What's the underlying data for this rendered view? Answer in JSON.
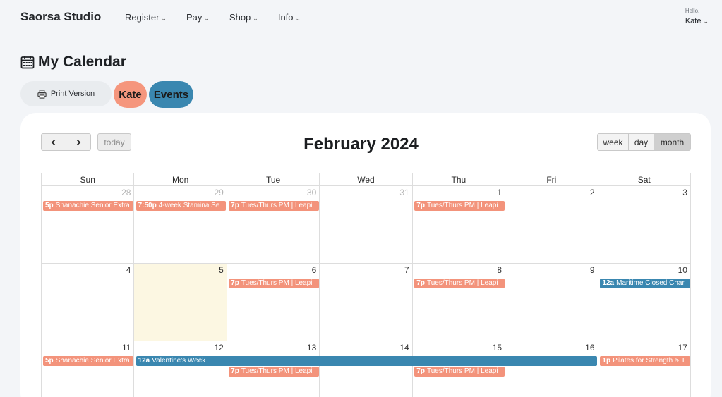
{
  "nav": {
    "brand": "Saorsa Studio",
    "menu": [
      {
        "label": "Register"
      },
      {
        "label": "Pay"
      },
      {
        "label": "Shop"
      },
      {
        "label": "Info"
      }
    ],
    "user": {
      "greeting": "Hello,",
      "name": "Kate"
    }
  },
  "page": {
    "title": "My Calendar",
    "print_label": "Print Version",
    "filters": [
      {
        "label": "Kate",
        "color": "#f5967d"
      },
      {
        "label": "Events",
        "color": "#3a87b0"
      }
    ]
  },
  "toolbar": {
    "prev_icon": "chevron-left-icon",
    "next_icon": "chevron-right-icon",
    "today_label": "today",
    "month_title": "February 2024",
    "views": [
      {
        "label": "week"
      },
      {
        "label": "day"
      },
      {
        "label": "month",
        "active": true
      }
    ]
  },
  "calendar": {
    "days_of_week": [
      "Sun",
      "Mon",
      "Tue",
      "Wed",
      "Thu",
      "Fri",
      "Sat"
    ],
    "weeks": [
      {
        "days": [
          {
            "num": "28",
            "other": true
          },
          {
            "num": "29",
            "other": true
          },
          {
            "num": "30",
            "other": true
          },
          {
            "num": "31",
            "other": true
          },
          {
            "num": "1"
          },
          {
            "num": "2"
          },
          {
            "num": "3"
          }
        ],
        "events": [
          {
            "time": "5p",
            "title": "Shanachie Senior Extra",
            "color": "orange",
            "col": 0,
            "span": 1,
            "lane": 0
          },
          {
            "time": "7:50p",
            "title": "4-week Stamina Se",
            "color": "orange",
            "col": 1,
            "span": 1,
            "lane": 0
          },
          {
            "time": "7p",
            "title": "Tues/Thurs PM | Leapi",
            "color": "orange",
            "col": 2,
            "span": 1,
            "lane": 0
          },
          {
            "time": "7p",
            "title": "Tues/Thurs PM | Leapi",
            "color": "orange",
            "col": 4,
            "span": 1,
            "lane": 0
          }
        ]
      },
      {
        "days": [
          {
            "num": "4"
          },
          {
            "num": "5",
            "today": true
          },
          {
            "num": "6"
          },
          {
            "num": "7"
          },
          {
            "num": "8"
          },
          {
            "num": "9"
          },
          {
            "num": "10"
          }
        ],
        "events": [
          {
            "time": "7p",
            "title": "Tues/Thurs PM | Leapi",
            "color": "orange",
            "col": 2,
            "span": 1,
            "lane": 0
          },
          {
            "time": "7p",
            "title": "Tues/Thurs PM | Leapi",
            "color": "orange",
            "col": 4,
            "span": 1,
            "lane": 0
          },
          {
            "time": "12a",
            "title": "Maritime Closed Char",
            "color": "blue",
            "col": 6,
            "span": 1,
            "lane": 0
          }
        ]
      },
      {
        "days": [
          {
            "num": "11"
          },
          {
            "num": "12"
          },
          {
            "num": "13"
          },
          {
            "num": "14"
          },
          {
            "num": "15"
          },
          {
            "num": "16"
          },
          {
            "num": "17"
          }
        ],
        "events": [
          {
            "time": "5p",
            "title": "Shanachie Senior Extra",
            "color": "orange",
            "col": 0,
            "span": 1,
            "lane": 0
          },
          {
            "time": "12a",
            "title": "Valentine's Week",
            "color": "blue",
            "col": 1,
            "span": 5,
            "lane": 0
          },
          {
            "time": "1p",
            "title": "Pilates for Strength & T",
            "color": "orange",
            "col": 6,
            "span": 1,
            "lane": 0
          },
          {
            "time": "7p",
            "title": "Tues/Thurs PM | Leapi",
            "color": "orange",
            "col": 2,
            "span": 1,
            "lane": 1
          },
          {
            "time": "7p",
            "title": "Tues/Thurs PM | Leapi",
            "color": "orange",
            "col": 4,
            "span": 1,
            "lane": 1
          }
        ]
      }
    ]
  }
}
